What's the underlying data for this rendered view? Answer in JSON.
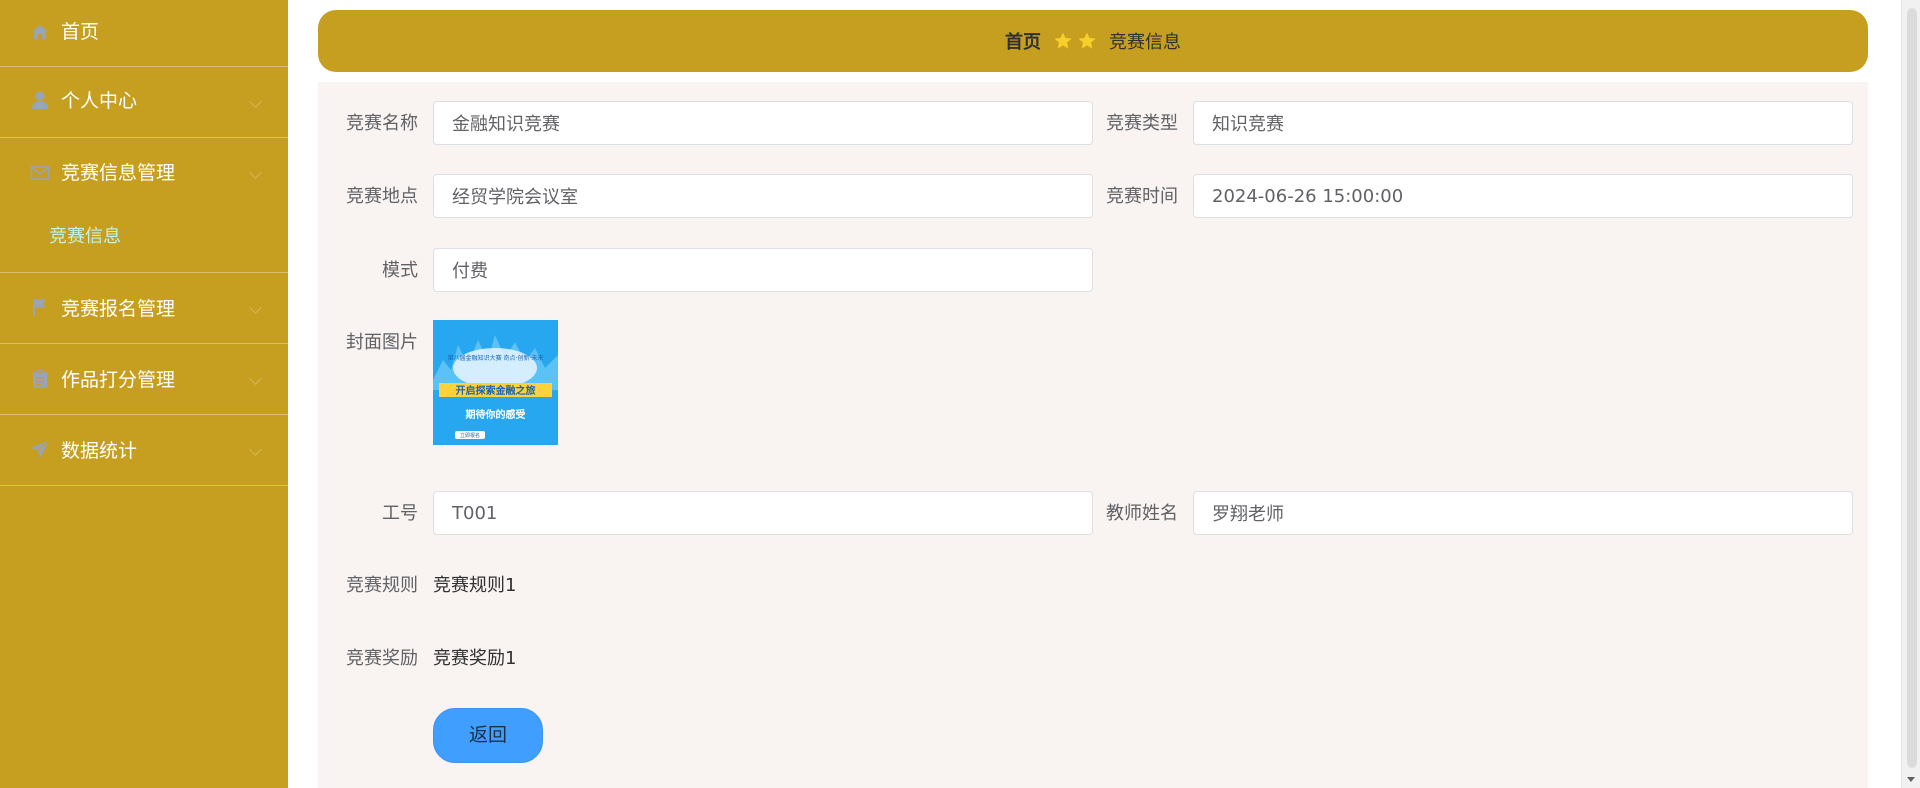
{
  "sidebar": {
    "items": [
      {
        "label": "首页",
        "icon": "home-icon"
      },
      {
        "label": "个人中心",
        "icon": "user-icon"
      },
      {
        "label": "竞赛信息管理",
        "icon": "mail-icon",
        "children": [
          {
            "label": "竞赛信息"
          }
        ]
      },
      {
        "label": "竞赛报名管理",
        "icon": "flag-icon"
      },
      {
        "label": "作品打分管理",
        "icon": "clipboard-icon"
      },
      {
        "label": "数据统计",
        "icon": "send-icon"
      }
    ]
  },
  "breadcrumb": {
    "home": "首页",
    "current": "竞赛信息",
    "separator_icon": "star-icon"
  },
  "form": {
    "name": {
      "label": "竞赛名称",
      "value": "金融知识竞赛"
    },
    "type": {
      "label": "竞赛类型",
      "value": "知识竞赛"
    },
    "location": {
      "label": "竞赛地点",
      "value": "经贸学院会议室"
    },
    "time": {
      "label": "竞赛时间",
      "value": "2024-06-26 15:00:00"
    },
    "mode": {
      "label": "模式",
      "value": "付费"
    },
    "cover": {
      "label": "封面图片",
      "image_text": [
        "第八届金融知识大赛  奇点·创新·未来",
        "开启探索金融之旅",
        "期待你的感受",
        "立即报名"
      ]
    },
    "teacher_id": {
      "label": "工号",
      "value": "T001"
    },
    "teacher_name": {
      "label": "教师姓名",
      "value": "罗翔老师"
    },
    "rules": {
      "label": "竞赛规则",
      "value": "竞赛规则1"
    },
    "reward": {
      "label": "竞赛奖励",
      "value": "竞赛奖励1"
    }
  },
  "actions": {
    "back_label": "返回"
  },
  "colors": {
    "sidebar": "#c69f20",
    "form_bg": "#f9f3f2",
    "accent": "#409eff",
    "submenu_text": "#bff2ea",
    "star": "#f7cf2b"
  }
}
